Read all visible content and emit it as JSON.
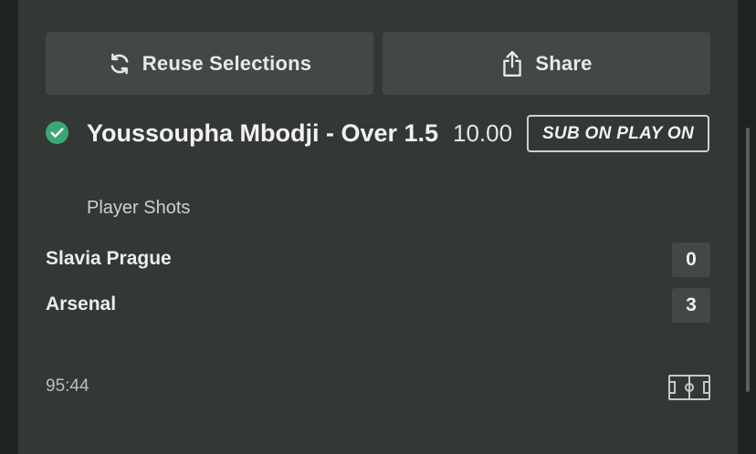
{
  "actions": {
    "reuse_label": "Reuse Selections",
    "share_label": "Share"
  },
  "selection": {
    "title": "Youssoupha Mbodji - Over 1.5",
    "market": "Player Shots",
    "odds": "10.00",
    "badge": "SUB ON PLAY ON",
    "status": "won"
  },
  "match": {
    "home_team": "Slavia Prague",
    "home_score": "0",
    "away_team": "Arsenal",
    "away_score": "3",
    "clock": "95:44"
  },
  "icons": {
    "reuse": "refresh-icon",
    "share": "share-icon",
    "status": "check-circle-icon",
    "stats": "pitch-icon"
  },
  "colors": {
    "success": "#3aa776",
    "panel": "#333835",
    "button": "#434845"
  }
}
